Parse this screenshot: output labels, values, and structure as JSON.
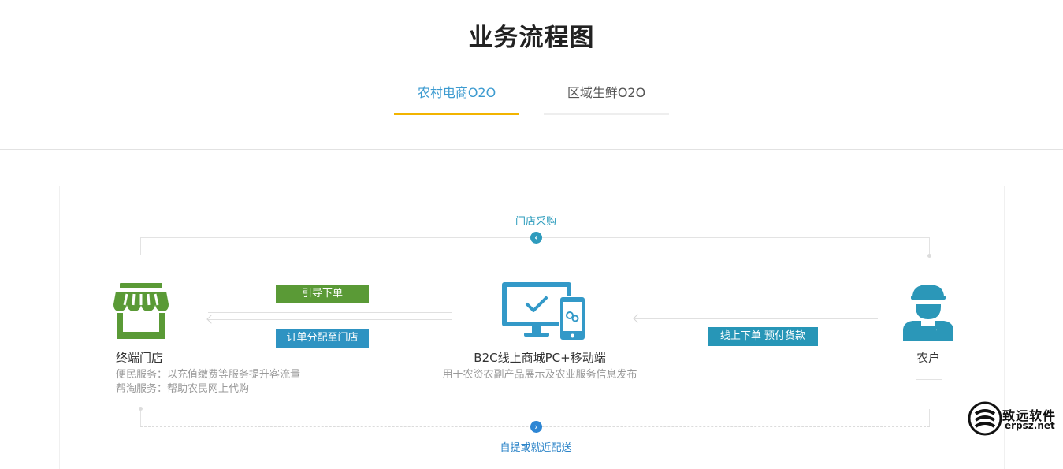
{
  "page": {
    "title": "业务流程图"
  },
  "tabs": [
    {
      "label": "农村电商O2O",
      "active": true
    },
    {
      "label": "区域生鲜O2O",
      "active": false
    }
  ],
  "flow": {
    "top_route": "门店采购",
    "bottom_route": "自提或就近配送",
    "arrows": {
      "guide_order": "引导下单",
      "assign_order": "订单分配至门店",
      "online_order": "线上下单  预付货款"
    },
    "store": {
      "title": "终端门店",
      "desc_lines": [
        "便民服务：以充值缴费等服务提升客流量",
        "帮淘服务：帮助农民网上代购"
      ]
    },
    "mall": {
      "title": "B2C线上商城PC+移动端",
      "desc": "用于农资农副产品展示及农业服务信息发布"
    },
    "farmer": {
      "title": "农户"
    }
  },
  "watermark": {
    "name": "致远软件",
    "url": "erpsz.net"
  },
  "colors": {
    "accent_blue": "#3d9bd0",
    "tab_underline": "#f2b400",
    "tag_green": "#5a9a36",
    "tag_blue": "#2e93c2",
    "icon_green": "#5a9a36",
    "icon_blue": "#3399c8",
    "icon_teal": "#2b97b8"
  },
  "icons": {
    "store": "storefront-icon",
    "mall": "monitor-phone-icon",
    "farmer": "farmer-icon",
    "top_circle": "chevron-left-icon",
    "bottom_circle": "chevron-right-icon"
  }
}
